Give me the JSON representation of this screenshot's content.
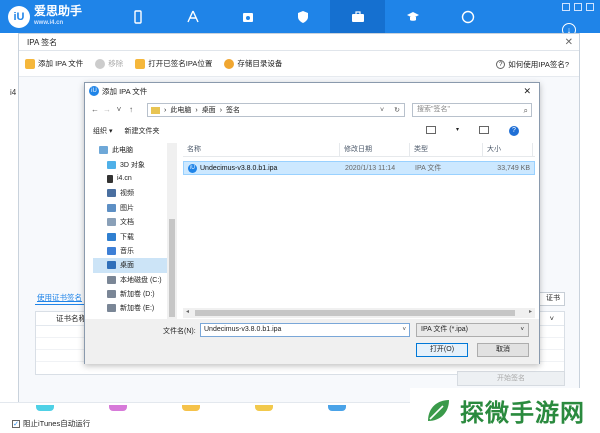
{
  "app": {
    "logo_badge": "iU",
    "logo_text": "爱思助手",
    "logo_sub": "www.i4.cn",
    "nav_icons": [
      "phone-icon",
      "appstore-icon",
      "music-icon",
      "shield-icon",
      "toolbox-icon",
      "graduation-icon",
      "compass-icon"
    ],
    "active_nav_index": 4,
    "side_label": "i4",
    "help_glyph": "↓"
  },
  "sign_dialog": {
    "title": "IPA 签名",
    "toolbar": {
      "add_ipa": "添加 IPA 文件",
      "remove": "移除",
      "open_signed": "打开已签名IPA位置",
      "storage_device": "存储目录设备",
      "how_to": "如何使用IPA签名?"
    },
    "cert_tab": "使用证书签名",
    "cert_header": "证书名称",
    "right_button": "证书",
    "start_sign": "开始签名"
  },
  "file_dialog": {
    "title": "添加 IPA 文件",
    "title_icon": "iU",
    "breadcrumb": [
      "此电脑",
      "桌面",
      "签名"
    ],
    "search_placeholder": "搜索\"签名\"",
    "organize": "组织 ▾",
    "new_folder": "新建文件夹",
    "nav_items": [
      {
        "label": "此电脑",
        "icon": "pc-icon",
        "color": "#6ea8d8"
      },
      {
        "label": "3D 对象",
        "icon": "cube-icon",
        "color": "#4fb0e8"
      },
      {
        "label": "i4.cn",
        "icon": "phone-icon",
        "color": "#333333"
      },
      {
        "label": "视频",
        "icon": "video-icon",
        "color": "#4a6fa0"
      },
      {
        "label": "图片",
        "icon": "picture-icon",
        "color": "#5d8fc4"
      },
      {
        "label": "文档",
        "icon": "document-icon",
        "color": "#8aa0b8"
      },
      {
        "label": "下载",
        "icon": "download-icon",
        "color": "#2f7fd0"
      },
      {
        "label": "音乐",
        "icon": "music-icon",
        "color": "#3d7fd6"
      },
      {
        "label": "桌面",
        "icon": "desktop-icon",
        "color": "#2f6fba"
      },
      {
        "label": "本地磁盘 (C:)",
        "icon": "drive-icon",
        "color": "#7a8696"
      },
      {
        "label": "新加卷 (D:)",
        "icon": "drive-icon",
        "color": "#7a8696"
      },
      {
        "label": "新加卷 (E:)",
        "icon": "drive-icon",
        "color": "#7a8696"
      }
    ],
    "selected_nav_index": 8,
    "columns": {
      "name": "名称",
      "date": "修改日期",
      "type": "类型",
      "size": "大小"
    },
    "files": [
      {
        "name": "Undecimus-v3.8.0.b1.ipa",
        "date": "2020/1/13 11:14",
        "type": "IPA 文件",
        "size": "33,749 KB"
      }
    ],
    "filename_label": "文件名(N):",
    "filename_value": "Undecimus-v3.8.0.b1.ipa",
    "filetype": "IPA 文件 (*.ipa)",
    "open_button": "打开(O)",
    "cancel_button": "取消"
  },
  "bottom": {
    "itunes_check": "阻止iTunes自动运行",
    "app_colors": [
      "#4fd1e6",
      "#d77ad9",
      "#f5c24a",
      "#f2c94c",
      "#4aa3e8"
    ]
  },
  "watermark": {
    "text": "探微手游网"
  },
  "colors": {
    "brand": "#1f84e8",
    "selection": "#cce8ff"
  }
}
